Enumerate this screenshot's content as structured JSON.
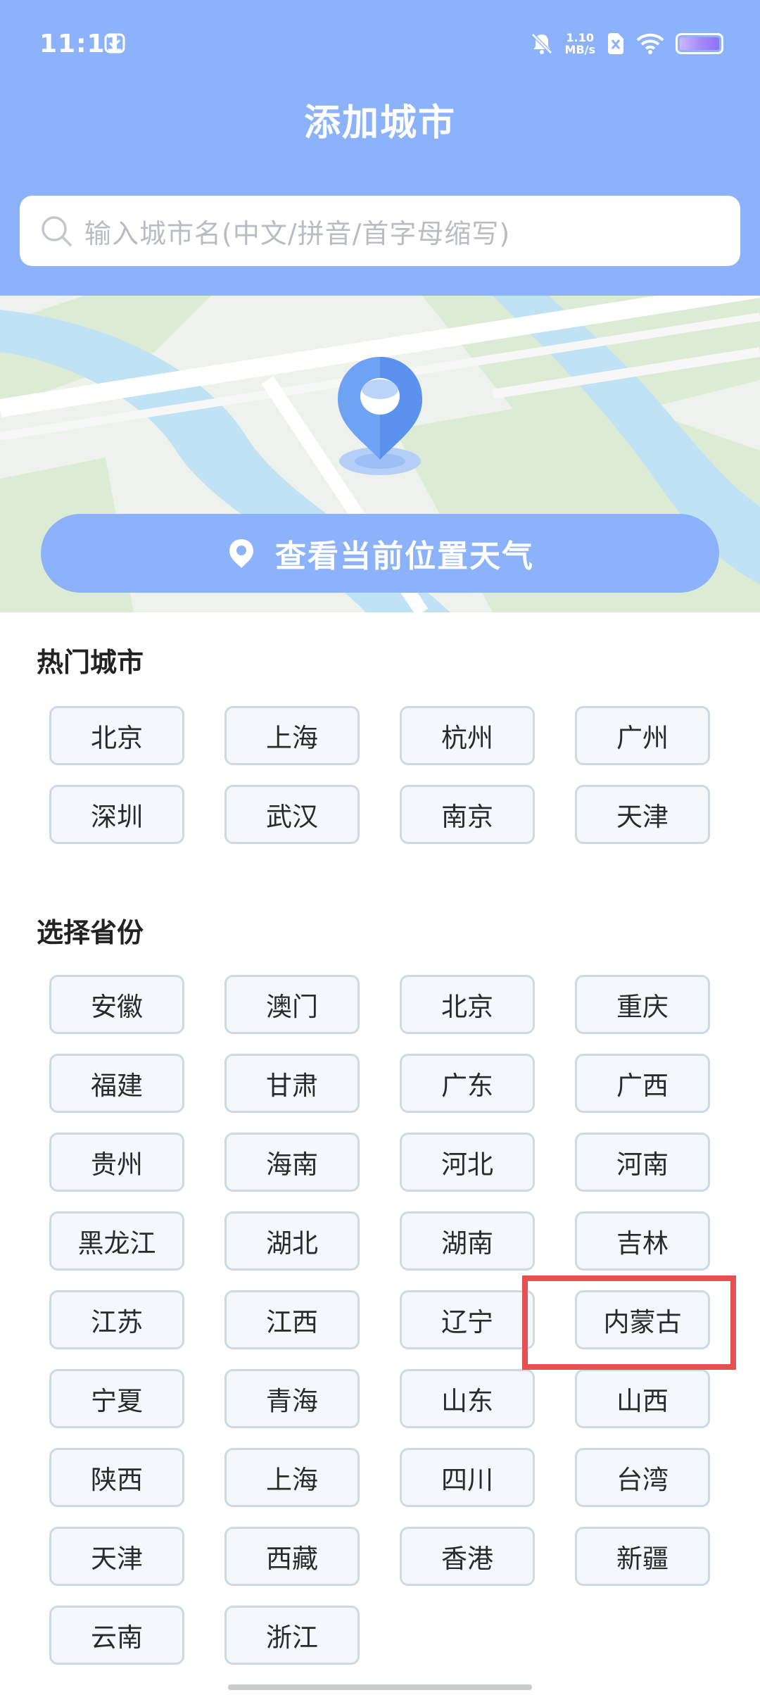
{
  "status_bar": {
    "time": "11:11",
    "net_speed_value": "1.10",
    "net_speed_unit": "MB/s"
  },
  "header": {
    "title": "添加城市"
  },
  "search": {
    "placeholder": "输入城市名(中文/拼音/首字母缩写)"
  },
  "location": {
    "button_label": "查看当前位置天气"
  },
  "hot_cities": {
    "title": "热门城市",
    "items": [
      "北京",
      "上海",
      "杭州",
      "广州",
      "深圳",
      "武汉",
      "南京",
      "天津"
    ]
  },
  "provinces": {
    "title": "选择省份",
    "items": [
      "安徽",
      "澳门",
      "北京",
      "重庆",
      "福建",
      "甘肃",
      "广东",
      "广西",
      "贵州",
      "海南",
      "河北",
      "河南",
      "黑龙江",
      "湖北",
      "湖南",
      "吉林",
      "江苏",
      "江西",
      "辽宁",
      "内蒙古",
      "宁夏",
      "青海",
      "山东",
      "山西",
      "陕西",
      "上海",
      "四川",
      "台湾",
      "天津",
      "西藏",
      "香港",
      "新疆",
      "云南",
      "浙江"
    ]
  },
  "colors": {
    "header_bg": "#8bb2fb",
    "button_bg": "#f4f8fd",
    "button_border": "#cfd9e3",
    "highlight": "#e55050"
  }
}
